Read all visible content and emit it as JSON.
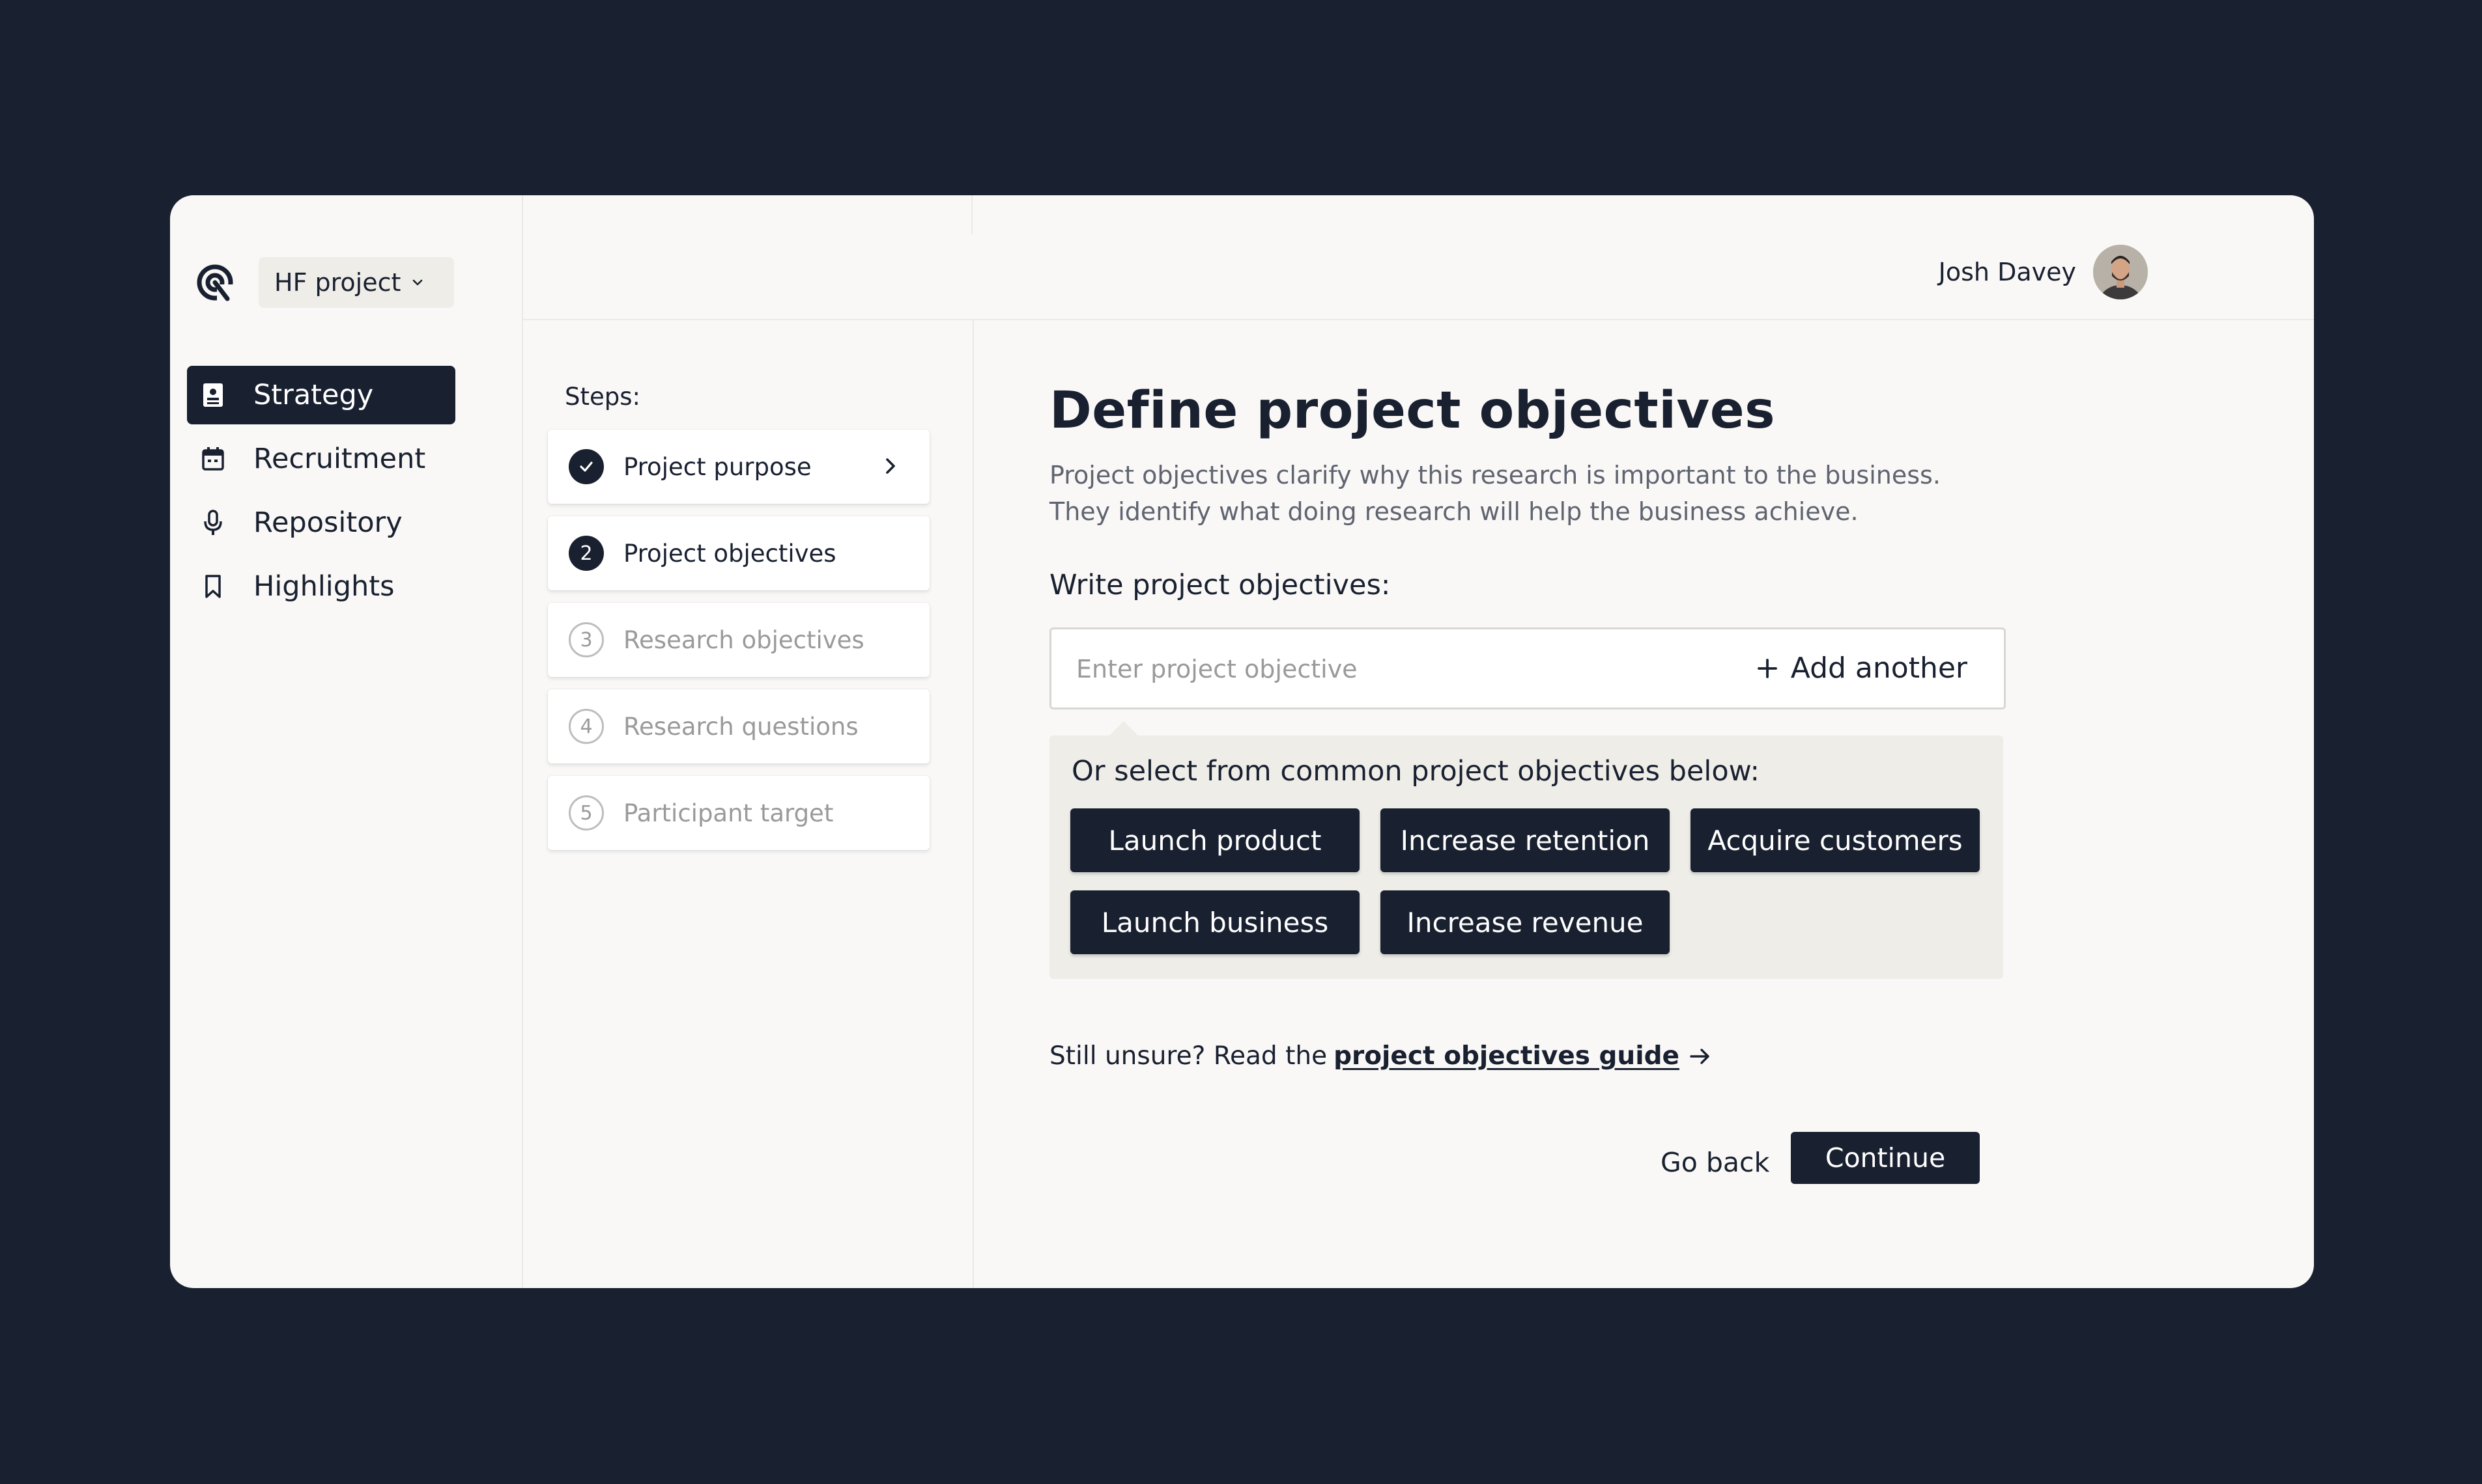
{
  "project": {
    "name": "HF project"
  },
  "sidebar": {
    "items": [
      {
        "label": "Strategy",
        "icon": "strategy-icon",
        "active": true
      },
      {
        "label": "Recruitment",
        "icon": "calendar-icon"
      },
      {
        "label": "Repository",
        "icon": "microphone-icon"
      },
      {
        "label": "Highlights",
        "icon": "bookmark-icon"
      }
    ]
  },
  "user": {
    "name": "Josh Davey"
  },
  "steps": {
    "label": "Steps:",
    "items": [
      {
        "number": "1",
        "label": "Project purpose",
        "state": "done"
      },
      {
        "number": "2",
        "label": "Project objectives",
        "state": "current"
      },
      {
        "number": "3",
        "label": "Research objectives",
        "state": "todo"
      },
      {
        "number": "4",
        "label": "Research questions",
        "state": "todo"
      },
      {
        "number": "5",
        "label": "Participant target",
        "state": "todo"
      }
    ]
  },
  "main": {
    "title": "Define project objectives",
    "description_line1": "Project objectives clarify why this research is important to the business.",
    "description_line2": "They identify what doing research will help the business achieve.",
    "write_label": "Write project objectives:",
    "input_placeholder": "Enter project objective",
    "input_value": "",
    "add_another": "Add another",
    "suggest_label": "Or select from common project objectives below:",
    "chips": [
      "Launch product",
      "Increase retention",
      "Acquire customers",
      "Launch business",
      "Increase revenue"
    ],
    "guide_prefix": "Still unsure? Read the",
    "guide_link": "project objectives guide",
    "go_back": "Go back",
    "continue": "Continue"
  },
  "colors": {
    "dark": "#192030",
    "panel": "#f9f8f6",
    "muted": "#9a9a9a"
  }
}
